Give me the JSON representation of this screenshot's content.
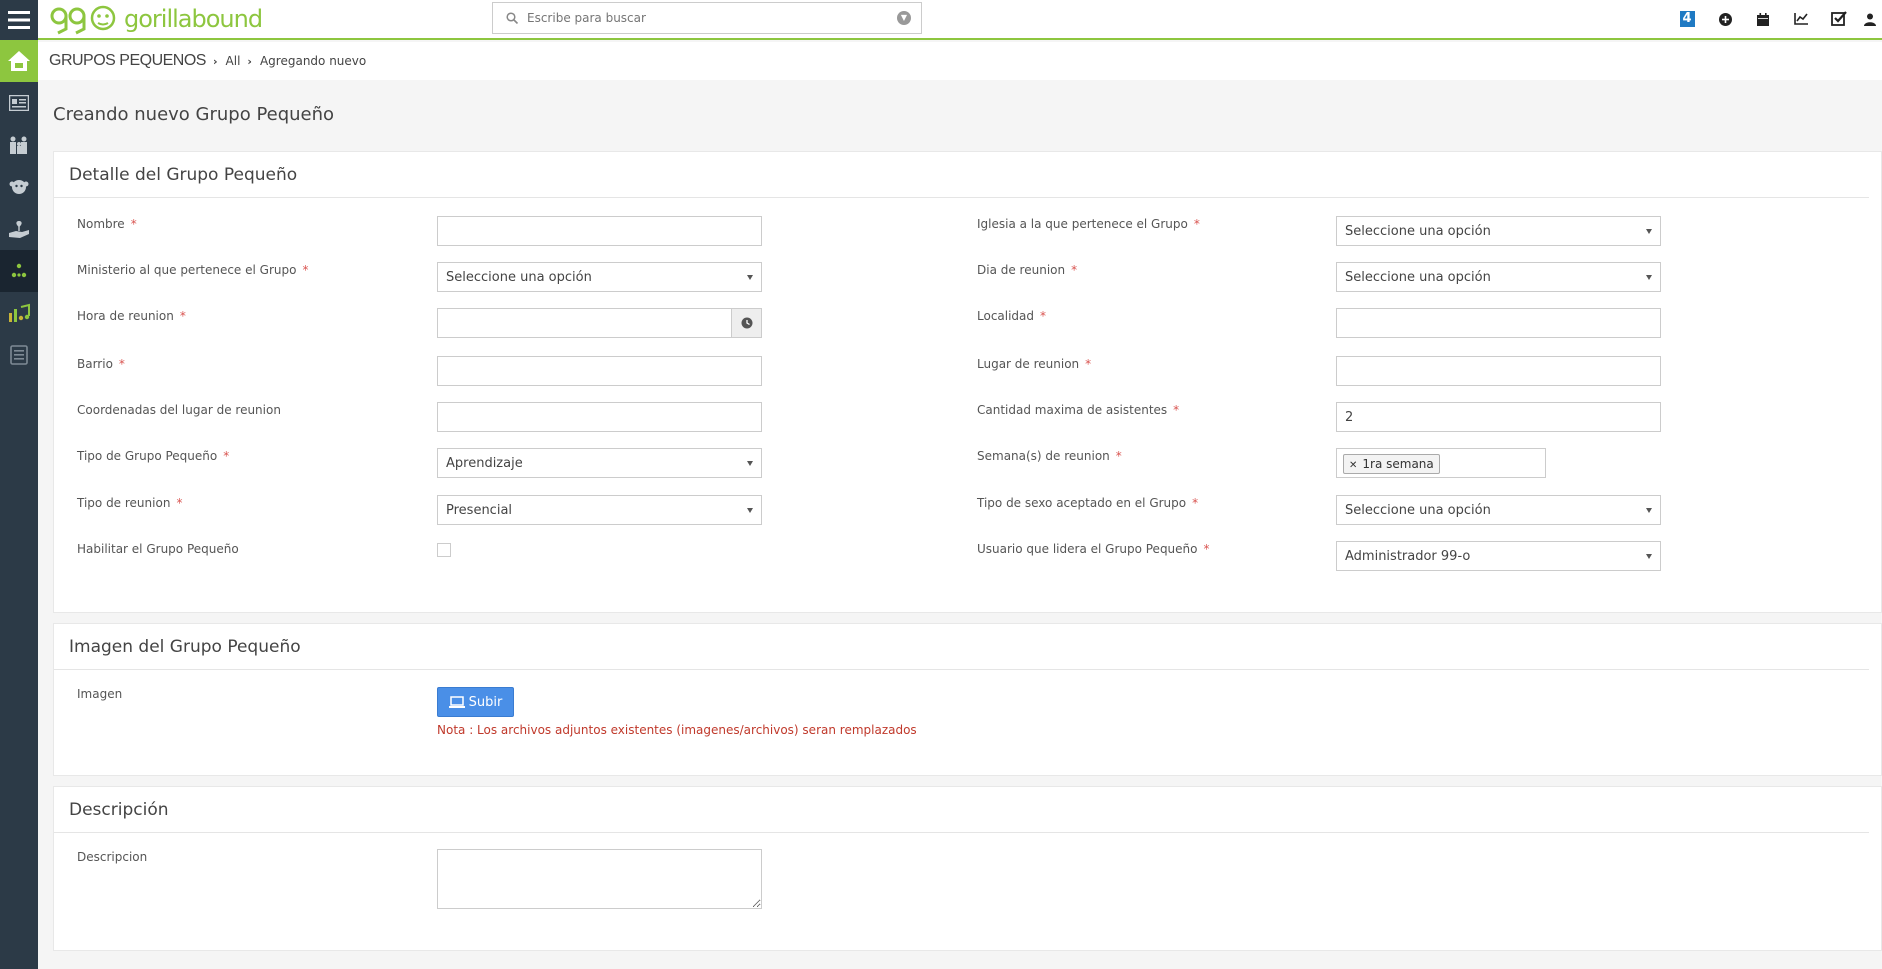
{
  "app": {
    "brand_name": "gorillabound",
    "brand_color": "#8dc63f"
  },
  "sidebar": {
    "items": [
      {
        "icon": "home-icon"
      },
      {
        "icon": "id-card-icon"
      },
      {
        "icon": "family-icon"
      },
      {
        "icon": "gorilla-icon"
      },
      {
        "icon": "hand-plant-icon"
      },
      {
        "icon": "groups-icon",
        "active": true
      },
      {
        "icon": "chart-music-icon"
      },
      {
        "icon": "list-icon"
      }
    ]
  },
  "search": {
    "placeholder": "Escribe para buscar"
  },
  "topbar": {
    "notification_count": "4",
    "icons": [
      "add-icon",
      "calendar-icon",
      "chart-icon",
      "tasks-icon",
      "user-icon"
    ]
  },
  "breadcrumb": {
    "module": "GRUPOS PEQUENOS",
    "all": "All",
    "current": "Agregando nuevo"
  },
  "page": {
    "title": "Creando nuevo Grupo Pequeño"
  },
  "detail": {
    "heading": "Detalle del Grupo Pequeño",
    "left": {
      "nombre": {
        "label": "Nombre",
        "value": ""
      },
      "ministerio": {
        "label": "Ministerio al que pertenece el Grupo",
        "value": "Seleccione una opción"
      },
      "hora": {
        "label": "Hora de reunion",
        "value": ""
      },
      "barrio": {
        "label": "Barrio",
        "value": ""
      },
      "coordenadas": {
        "label": "Coordenadas del lugar de reunion",
        "value": ""
      },
      "tipo_grupo": {
        "label": "Tipo de Grupo Pequeño",
        "value": "Aprendizaje"
      },
      "tipo_reunion": {
        "label": "Tipo de reunion",
        "value": "Presencial"
      },
      "habilitar": {
        "label": "Habilitar el Grupo Pequeño",
        "checked": false
      }
    },
    "right": {
      "iglesia": {
        "label": "Iglesia a la que pertenece el Grupo",
        "value": "Seleccione una opción"
      },
      "dia": {
        "label": "Dia de reunion",
        "value": "Seleccione una opción"
      },
      "localidad": {
        "label": "Localidad",
        "value": ""
      },
      "lugar": {
        "label": "Lugar de reunion",
        "value": ""
      },
      "cantidad": {
        "label": "Cantidad maxima de asistentes",
        "value": "2"
      },
      "semanas": {
        "label": "Semana(s) de reunion",
        "chip": "1ra semana"
      },
      "sexo": {
        "label": "Tipo de sexo aceptado en el Grupo",
        "value": "Seleccione una opción"
      },
      "usuario": {
        "label": "Usuario que lidera el Grupo Pequeño",
        "value": "Administrador 99-o"
      }
    },
    "required_mark": "*"
  },
  "imagen": {
    "heading": "Imagen del Grupo Pequeño",
    "label": "Imagen",
    "upload_label": "Subir",
    "note": "Nota : Los archivos adjuntos existentes (imagenes/archivos) seran remplazados"
  },
  "descripcion": {
    "heading": "Descripción",
    "label": "Descripcion",
    "value": ""
  }
}
